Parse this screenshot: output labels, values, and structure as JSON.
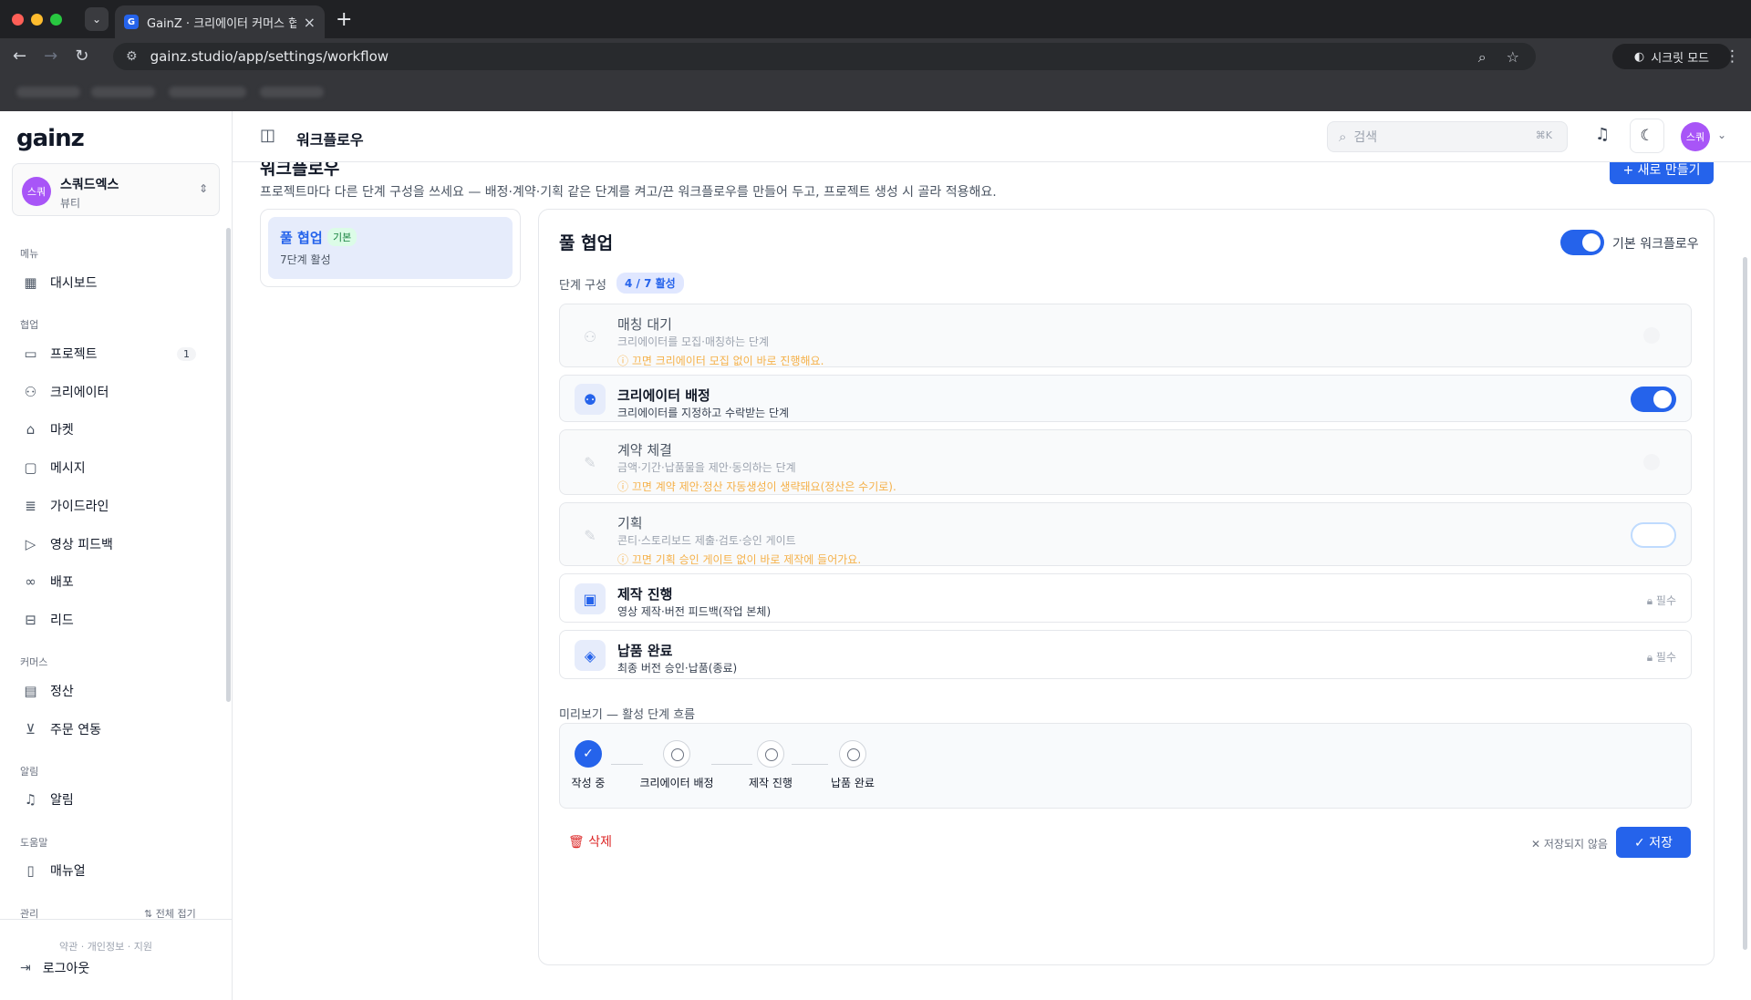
{
  "browser": {
    "tab_title": "GainZ · 크리에이터 커머스 협업 C",
    "favicon": "G",
    "url": "gainz.studio/app/settings/workflow",
    "incognito_label": "시크릿 모드"
  },
  "sidebar": {
    "logo": "gainz",
    "workspace": {
      "avatar": "스쿼",
      "name": "스쿼드엑스",
      "sub": "뷰티"
    },
    "sections": {
      "menu": "메뉴",
      "collab": "협업",
      "commerce": "커머스",
      "alerts": "알림",
      "help": "도움말",
      "admin": "관리"
    },
    "items": {
      "dashboard": "대시보드",
      "projects": "프로젝트",
      "projects_badge": "1",
      "creators": "크리에이터",
      "market": "마켓",
      "messages": "메시지",
      "guideline": "가이드라인",
      "video_feedback": "영상 피드백",
      "distribution": "배포",
      "leads": "리드",
      "settlement": "정산",
      "order_link": "주문 연동",
      "notifications": "알림",
      "manual": "매뉴얼"
    },
    "collapse_all": "전체 접기",
    "footer_links": "약관 · 개인정보 · 지원",
    "logout": "로그아웃"
  },
  "topbar": {
    "title": "워크플로우",
    "search_placeholder": "검색",
    "search_kbd": "⌘K",
    "user_avatar": "스쿼"
  },
  "page": {
    "heading": "워크플로우",
    "description": "프로젝트마다 다른 단계 구성을 쓰세요 — 배정·계약·기획 같은 단계를 켜고/끈 워크플로우를 만들어 두고, 프로젝트 생성 시 골라 적용해요.",
    "new_button": "+ 새로 만들기"
  },
  "workflow_list": [
    {
      "name": "풀 협업",
      "badge": "기본",
      "sub": "7단계 활성"
    }
  ],
  "editor": {
    "title": "풀 협업",
    "default_label": "기본 워크플로우",
    "default_on": true,
    "steps_label": "단계 구성",
    "steps_count": "4 / 7 활성",
    "steps": [
      {
        "name": "매칭 대기",
        "desc": "크리에이터를 모집·매칭하는 단계",
        "warn": "ⓘ 끄면 크리에이터 모집 없이 바로 진행해요.",
        "state": "ghost",
        "icon": "users-icon"
      },
      {
        "name": "크리에이터 배정",
        "desc": "크리에이터를 지정하고 수락받는 단계",
        "warn": "",
        "state": "on",
        "icon": "user-plus-icon"
      },
      {
        "name": "계약 체결",
        "desc": "금액·기간·납품물을 제안·동의하는 단계",
        "warn": "ⓘ 끄면 계약 제안·정산 자동생성이 생략돼요(정산은 수기로).",
        "state": "ghost",
        "icon": "file-edit-icon"
      },
      {
        "name": "기획",
        "desc": "콘티·스토리보드 제출·검토·승인 게이트",
        "warn": "ⓘ 끄면 기획 승인 게이트 없이 바로 제작에 들어가요.",
        "state": "off",
        "icon": "file-edit-icon"
      },
      {
        "name": "제작 진행",
        "desc": "영상 제작·버전 피드백(작업 본체)",
        "warn": "",
        "state": "required",
        "icon": "clapper-icon"
      },
      {
        "name": "납품 완료",
        "desc": "최종 버전 승인·납품(종료)",
        "warn": "",
        "state": "required",
        "icon": "box-icon"
      }
    ],
    "required_label": "필수",
    "preview_label": "미리보기 — 활성 단계 흐름",
    "preview_steps": [
      "작성 중",
      "크리에이터 배정",
      "제작 진행",
      "납품 완료"
    ],
    "delete_label": "삭제",
    "unsaved_label": "✕ 저장되지 않음",
    "save_label": "✓ 저장"
  }
}
